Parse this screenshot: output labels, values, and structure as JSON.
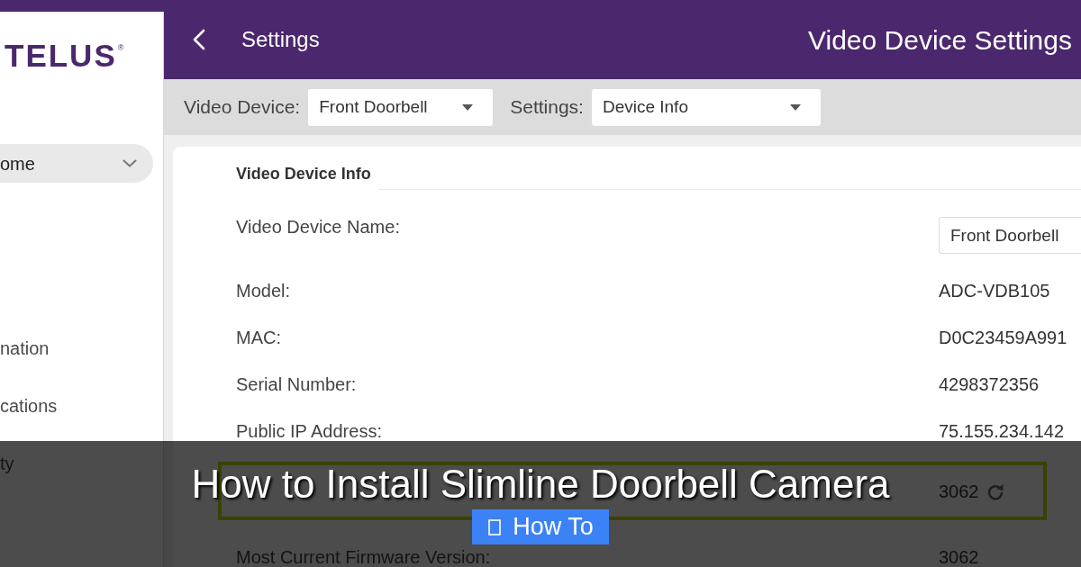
{
  "sidebar": {
    "logo": {
      "text": "TELUS",
      "mark": "®"
    },
    "items": [
      {
        "label": "ome",
        "kind": "group",
        "selected": true
      },
      {
        "label": "nation",
        "kind": "link",
        "selected": false
      },
      {
        "label": "cations",
        "kind": "link",
        "selected": false
      },
      {
        "label": "ty",
        "kind": "link",
        "selected": false
      }
    ]
  },
  "header": {
    "title": "Settings",
    "page_title": "Video Device Settings"
  },
  "toolbar": {
    "selectors": [
      {
        "label": "Video Device:",
        "value": "Front Doorbell"
      },
      {
        "label": "Settings:",
        "value": "Device Info"
      }
    ]
  },
  "device_info": {
    "heading": "Video Device Info",
    "fields": [
      {
        "kind": "input",
        "label": "Video Device Name:",
        "value": "Front Doorbell",
        "highlighted": false
      },
      {
        "kind": "text",
        "label": "Model:",
        "value": "ADC-VDB105",
        "highlighted": false
      },
      {
        "kind": "text",
        "label": "MAC:",
        "value": "D0C23459A991",
        "highlighted": false
      },
      {
        "kind": "text",
        "label": "Serial Number:",
        "value": "4298372356",
        "highlighted": false
      },
      {
        "kind": "text",
        "label": "Public IP Address:",
        "value": "75.155.234.142",
        "highlighted": false
      },
      {
        "kind": "refresh",
        "value": "3062",
        "highlighted": true
      },
      {
        "kind": "text",
        "label": "Most Current Firmware Version:",
        "value": "3062",
        "highlighted": false
      }
    ]
  },
  "overlay": {
    "title": "How to Install Slimline Doorbell Camera",
    "badge": "How To"
  }
}
